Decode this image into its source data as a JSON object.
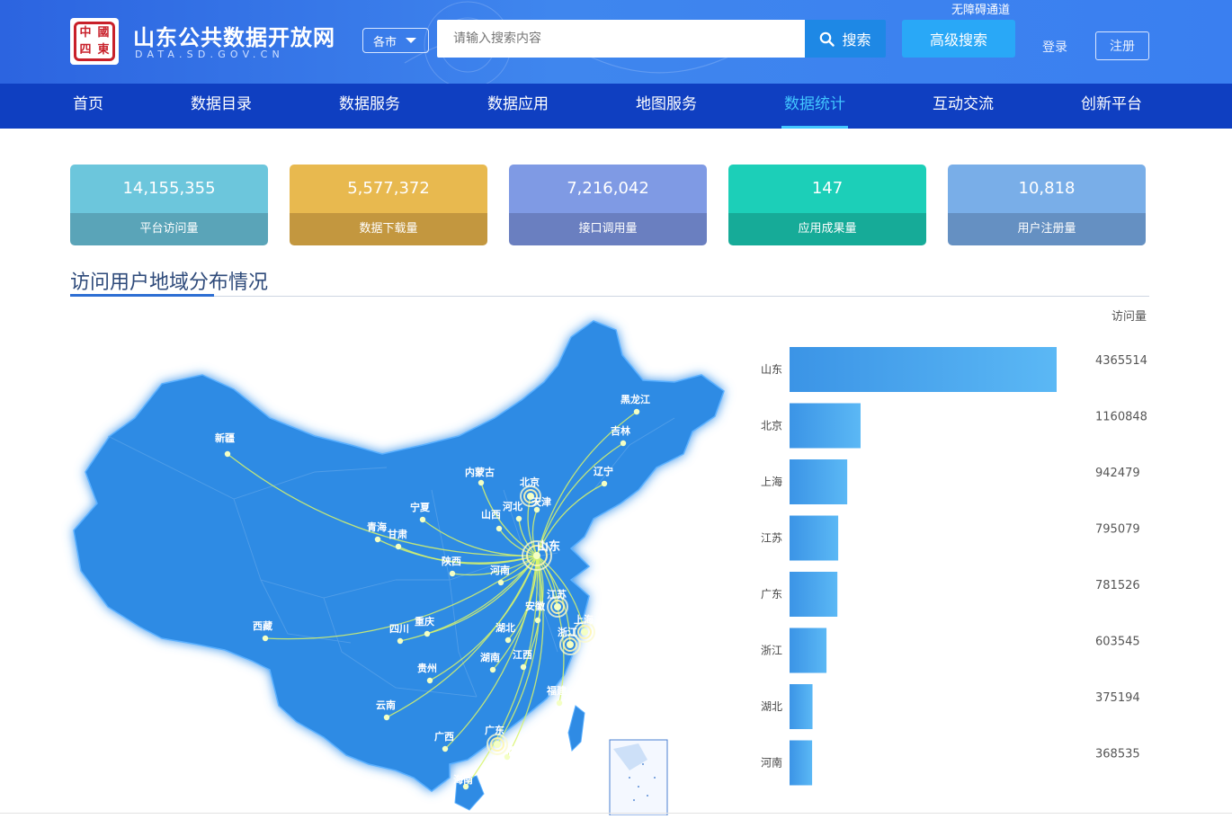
{
  "header": {
    "seal_text": [
      "中",
      "國",
      "四",
      "東"
    ],
    "title": "山东公共数据开放网",
    "subtitle": "DATA.SD.GOV.CN",
    "city_select": "各市",
    "search_placeholder": "请输入搜索内容",
    "search_label": "搜索",
    "advanced_search": "高级搜索",
    "accessibility": "无障碍通道",
    "login": "登录",
    "register": "注册"
  },
  "nav": {
    "items": [
      "首页",
      "数据目录",
      "数据服务",
      "数据应用",
      "地图服务",
      "数据统计",
      "互动交流",
      "创新平台"
    ],
    "active": "数据统计"
  },
  "stats": [
    {
      "value": "14,155,355",
      "label": "平台访问量",
      "top": "#6cc6dc",
      "bottom": "#5aa4b8"
    },
    {
      "value": "5,577,372",
      "label": "数据下载量",
      "top": "#e8b94f",
      "bottom": "#c3973f"
    },
    {
      "value": "7,216,042",
      "label": "接口调用量",
      "top": "#7f9ae4",
      "bottom": "#6a7fc0"
    },
    {
      "value": "147",
      "label": "应用成果量",
      "top": "#1ccfb8",
      "bottom": "#16ab98"
    },
    {
      "value": "10,818",
      "label": "用户注册量",
      "top": "#79aee8",
      "bottom": "#6590c2"
    }
  ],
  "section": {
    "title": "访问用户地域分布情况"
  },
  "map": {
    "provinces": [
      "新疆",
      "西藏",
      "青海",
      "甘肃",
      "宁夏",
      "内蒙古",
      "山西",
      "陕西",
      "四川",
      "重庆",
      "云南",
      "贵州",
      "广西",
      "广东",
      "湖南",
      "湖北",
      "河南",
      "河北",
      "北京",
      "天津",
      "山东",
      "辽宁",
      "吉林",
      "黑龙江",
      "江苏",
      "安徽",
      "上海",
      "浙江",
      "江西",
      "福建",
      "海南",
      "香港"
    ]
  },
  "chart_data": {
    "type": "bar",
    "orientation": "horizontal",
    "value_label": "访问量",
    "categories": [
      "山东",
      "北京",
      "上海",
      "江苏",
      "广东",
      "浙江",
      "湖北",
      "河南"
    ],
    "values": [
      4365514,
      1160848,
      942479,
      795079,
      781526,
      603545,
      375194,
      368535
    ],
    "xlim": [
      0,
      4365514
    ],
    "gradient": [
      "#3b94e6",
      "#5bb8f5"
    ]
  }
}
